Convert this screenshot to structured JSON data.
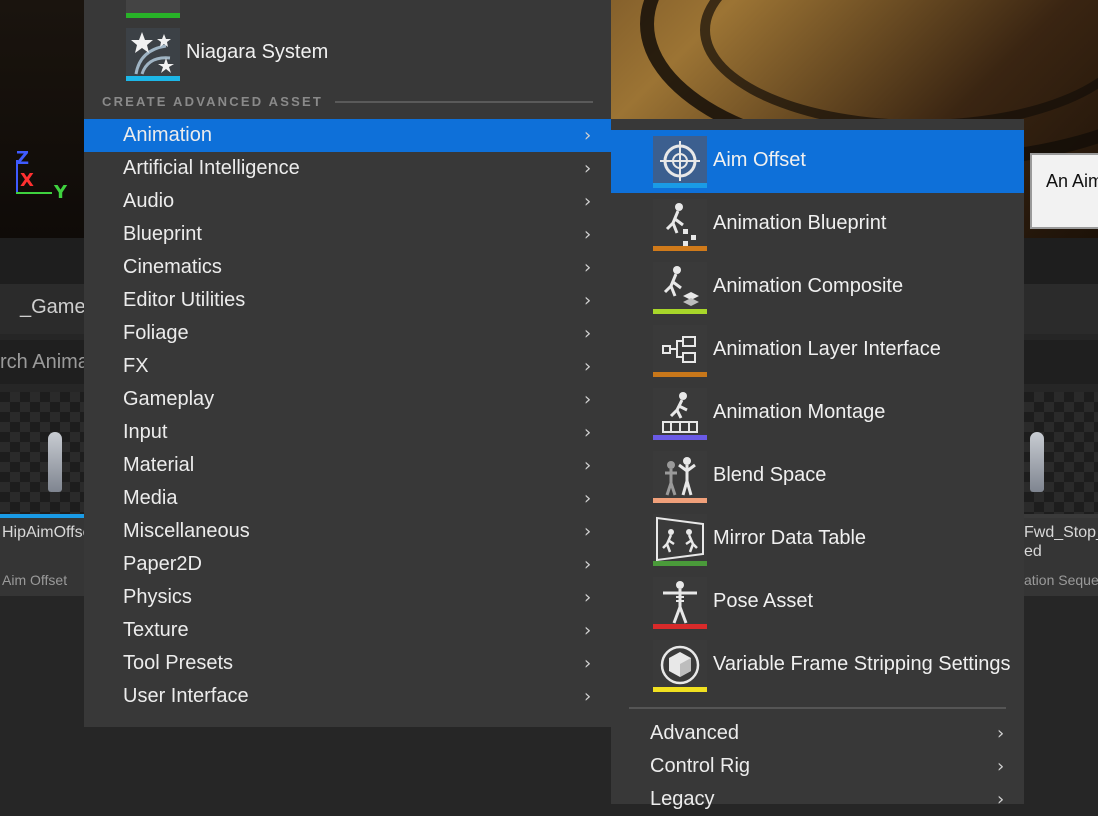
{
  "viewport": {
    "axis_z": "Z",
    "axis_x": "X",
    "axis_y": "Y"
  },
  "tooltip": {
    "text": "An Aim"
  },
  "content_browser": {
    "path": "_Game",
    "search_placeholder": "rch Anima",
    "tiles": [
      {
        "name": "HipAimOffse",
        "type": "Aim Offset"
      },
      {
        "name": "Fwd_Stop_",
        "name2": "ed",
        "type": "ation Seque..."
      }
    ]
  },
  "menu": {
    "niagara_label": "Niagara System",
    "section_header": "CREATE ADVANCED ASSET",
    "categories": [
      {
        "label": "Animation",
        "active": true
      },
      {
        "label": "Artificial Intelligence"
      },
      {
        "label": "Audio"
      },
      {
        "label": "Blueprint"
      },
      {
        "label": "Cinematics"
      },
      {
        "label": "Editor Utilities"
      },
      {
        "label": "Foliage"
      },
      {
        "label": "FX"
      },
      {
        "label": "Gameplay"
      },
      {
        "label": "Input"
      },
      {
        "label": "Material"
      },
      {
        "label": "Media"
      },
      {
        "label": "Miscellaneous"
      },
      {
        "label": "Paper2D"
      },
      {
        "label": "Physics"
      },
      {
        "label": "Texture"
      },
      {
        "label": "Tool Presets"
      },
      {
        "label": "User Interface"
      }
    ]
  },
  "submenu": {
    "items": [
      {
        "label": "Aim Offset",
        "icon": "aim-offset-icon",
        "color": "#1a9be6",
        "active": true
      },
      {
        "label": "Animation Blueprint",
        "icon": "animation-blueprint-icon",
        "color": "#d07a1a"
      },
      {
        "label": "Animation Composite",
        "icon": "animation-composite-icon",
        "color": "#a8d62a"
      },
      {
        "label": "Animation Layer Interface",
        "icon": "animation-layer-interface-icon",
        "color": "#c8771a"
      },
      {
        "label": "Animation Montage",
        "icon": "animation-montage-icon",
        "color": "#6a5ae6"
      },
      {
        "label": "Blend Space",
        "icon": "blend-space-icon",
        "color": "#f0a07a"
      },
      {
        "label": "Mirror Data Table",
        "icon": "mirror-data-table-icon",
        "color": "#4a9a3a"
      },
      {
        "label": "Pose Asset",
        "icon": "pose-asset-icon",
        "color": "#d82a2a"
      },
      {
        "label": "Variable Frame Stripping Settings",
        "icon": "variable-frame-stripping-icon",
        "color": "#f0e020"
      }
    ],
    "categories": [
      {
        "label": "Advanced"
      },
      {
        "label": "Control Rig"
      },
      {
        "label": "Legacy"
      }
    ]
  }
}
